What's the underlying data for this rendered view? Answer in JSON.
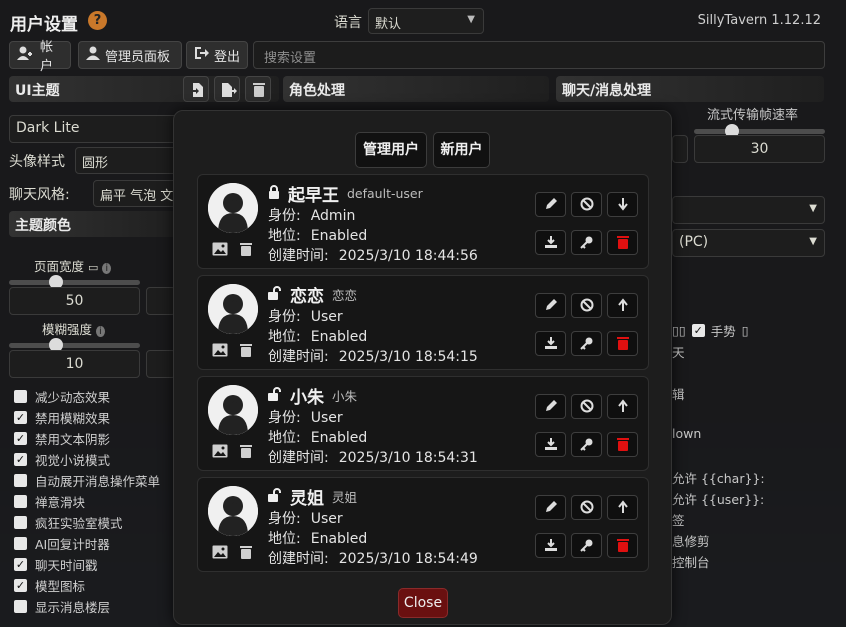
{
  "app": {
    "title": "用户设置",
    "version": "SillyTavern 1.12.12",
    "help": "?"
  },
  "language": {
    "label": "语言",
    "value": "默认"
  },
  "toolbar": {
    "account": "帐户",
    "admin_panel": "管理员面板",
    "logout": "登出",
    "search_placeholder": "搜索设置"
  },
  "sections": {
    "ui_theme": "UI主题",
    "character_handling": "角色处理",
    "chat_handling": "聊天/消息处理"
  },
  "left": {
    "theme_value": "Dark Lite",
    "avatar_style_label": "头像样式",
    "avatar_style_value": "圆形",
    "chat_style_label": "聊天风格:",
    "chat_style_value": "扁平 气泡 文",
    "theme_colors": "主题颜色",
    "page_width_label": "页面宽度",
    "page_width_value": "50",
    "blur_label": "模糊强度",
    "blur_value": "10",
    "checkboxes": [
      {
        "label": "减少动态效果",
        "checked": false
      },
      {
        "label": "禁用模糊效果",
        "checked": true
      },
      {
        "label": "禁用文本阴影",
        "checked": true
      },
      {
        "label": "视觉小说模式",
        "checked": true
      },
      {
        "label": "自动展开消息操作菜单",
        "checked": false
      },
      {
        "label": "禅意滑块",
        "checked": false
      },
      {
        "label": "疯狂实验室模式",
        "checked": false
      },
      {
        "label": "AI回复计时器",
        "checked": false
      },
      {
        "label": "聊天时间戳",
        "checked": true
      },
      {
        "label": "模型图标",
        "checked": true
      },
      {
        "label": "显示消息楼层",
        "checked": false
      }
    ]
  },
  "right": {
    "stream_label": "流式传输帧速率",
    "stream_value": "30",
    "pc_value": "(PC)",
    "gesture_label": "手势",
    "snippets": [
      "天",
      "辑",
      "lown",
      "允许 {{char}}:",
      "允许 {{user}}:",
      "签",
      "息修剪",
      "控制台"
    ]
  },
  "modal": {
    "tab_manage": "管理用户",
    "tab_new": "新用户",
    "role_label": "身份:",
    "status_label": "地位:",
    "created_label": "创建时间:",
    "close": "Close",
    "users": [
      {
        "name": "起早王",
        "handle": "default-user",
        "role": "Admin",
        "status": "Enabled",
        "created": "2025/3/10 18:44:56",
        "locked": true,
        "arrow": "down"
      },
      {
        "name": "恋恋",
        "handle": "恋恋",
        "role": "User",
        "status": "Enabled",
        "created": "2025/3/10 18:54:15",
        "locked": false,
        "arrow": "up"
      },
      {
        "name": "小朱",
        "handle": "小朱",
        "role": "User",
        "status": "Enabled",
        "created": "2025/3/10 18:54:31",
        "locked": false,
        "arrow": "up"
      },
      {
        "name": "灵姐",
        "handle": "灵姐",
        "role": "User",
        "status": "Enabled",
        "created": "2025/3/10 18:54:49",
        "locked": false,
        "arrow": "up"
      }
    ]
  },
  "colors": {
    "accent_orange": "#c9782a",
    "danger_red": "#e01010",
    "close_bg": "#6a1010"
  }
}
